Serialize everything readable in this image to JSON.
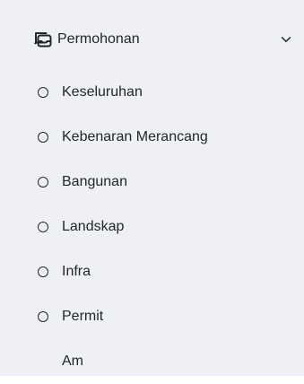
{
  "colors": {
    "panel_background": "#eef0f5",
    "text": "#23262b"
  },
  "section": {
    "label": "Permohonan",
    "icon": "stacked-documents-icon",
    "expanded": true,
    "toggle_icon": "chevron-down-icon"
  },
  "items": [
    {
      "label": "Keseluruhan",
      "icon": "circle-outline-icon"
    },
    {
      "label": "Kebenaran Merancang",
      "icon": "circle-outline-icon"
    },
    {
      "label": "Bangunan",
      "icon": "circle-outline-icon"
    },
    {
      "label": "Landskap",
      "icon": "circle-outline-icon"
    },
    {
      "label": "Infra",
      "icon": "circle-outline-icon"
    },
    {
      "label": "Permit",
      "icon": "circle-outline-icon"
    },
    {
      "label": "Am",
      "icon": ""
    }
  ]
}
